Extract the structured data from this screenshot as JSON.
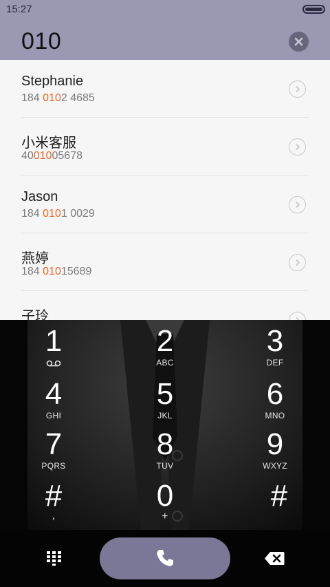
{
  "status_bar": {
    "time": "15:27"
  },
  "search": {
    "query": "010"
  },
  "results": [
    {
      "name": "Stephanie",
      "number_parts": [
        "184 ",
        "010",
        "2 4685"
      ]
    },
    {
      "name": "小米客服",
      "number_parts": [
        "40",
        "010",
        "05678"
      ]
    },
    {
      "name": "Jason",
      "number_parts": [
        "184 ",
        "010",
        "1 0029"
      ]
    },
    {
      "name": "燕婷",
      "number_parts": [
        "184 ",
        "010",
        "15689"
      ]
    },
    {
      "name": "子玲"
    }
  ],
  "keypad": {
    "keys": [
      {
        "digit": "1",
        "letters": ""
      },
      {
        "digit": "2",
        "letters": "ABC"
      },
      {
        "digit": "3",
        "letters": "DEF"
      },
      {
        "digit": "4",
        "letters": "GHI"
      },
      {
        "digit": "5",
        "letters": "JKL"
      },
      {
        "digit": "6",
        "letters": "MNO"
      },
      {
        "digit": "7",
        "letters": "PQRS"
      },
      {
        "digit": "8",
        "letters": "TUV"
      },
      {
        "digit": "9",
        "letters": "WXYZ"
      },
      {
        "digit": "#",
        "letters": ","
      },
      {
        "digit": "0",
        "letters": "+"
      },
      {
        "digit": "#",
        "letters": ""
      }
    ]
  },
  "colors": {
    "header_bg": "#9a98b3",
    "match_highlight": "#e8662a",
    "call_button": "#7a7896"
  },
  "icons": {
    "clear": "close-icon",
    "row_action": "chevron-right-icon",
    "voicemail": "voicemail-icon",
    "dialpad": "dialpad-icon",
    "call": "phone-icon",
    "backspace": "backspace-icon"
  }
}
